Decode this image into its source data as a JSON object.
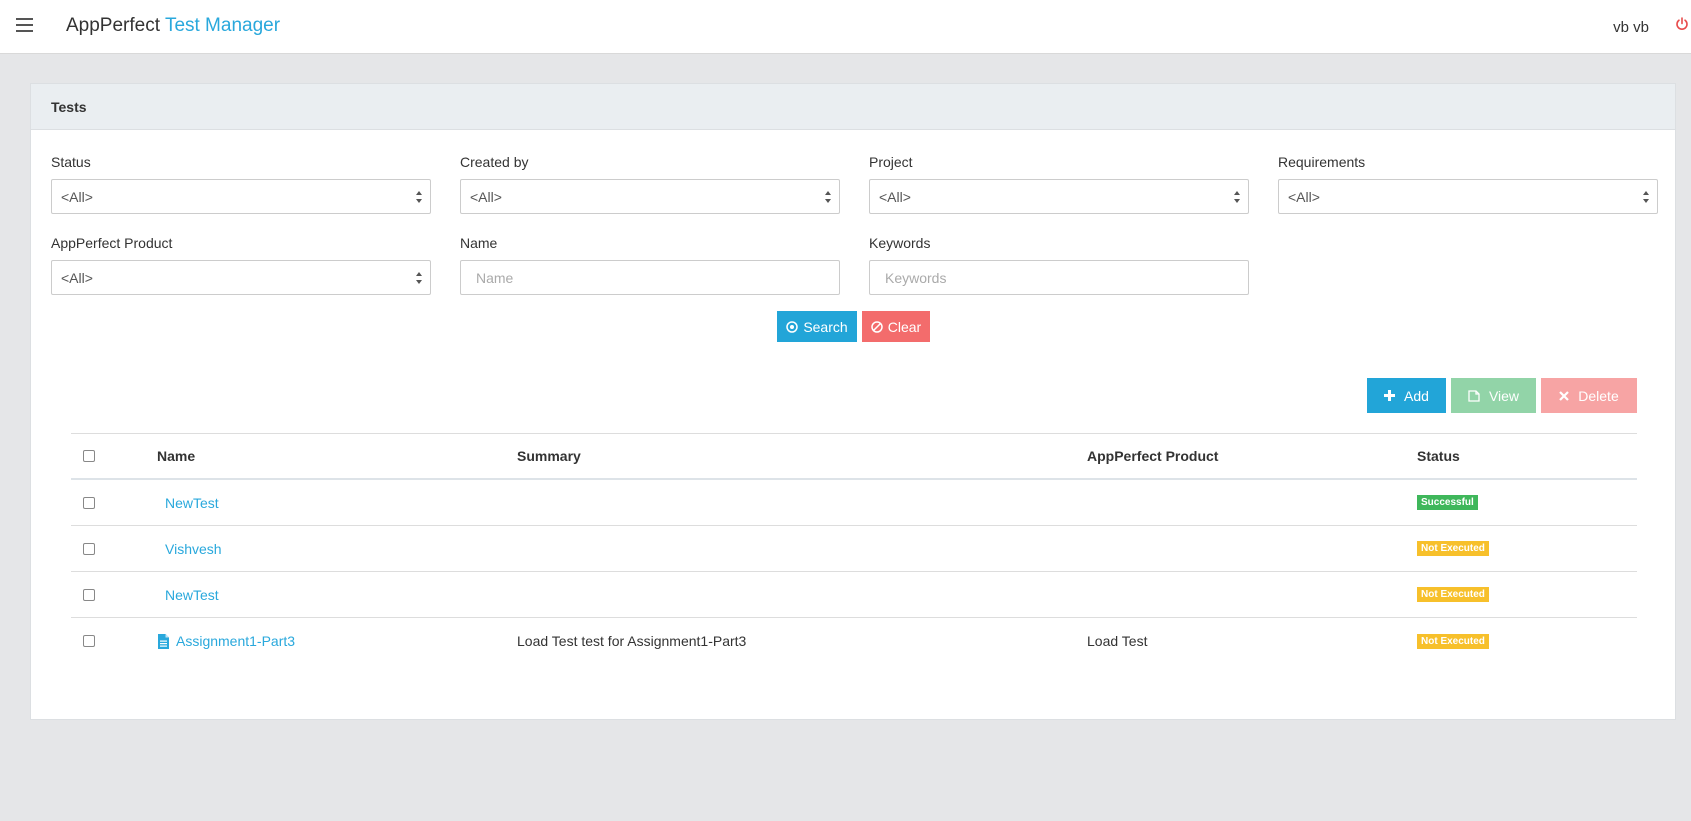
{
  "header": {
    "brand_main": "AppPerfect",
    "brand_accent": "Test Manager",
    "user_name": "vb vb"
  },
  "panel": {
    "title": "Tests"
  },
  "filters": {
    "status": {
      "label": "Status",
      "value": "<All>"
    },
    "created_by": {
      "label": "Created by",
      "value": "<All>"
    },
    "project": {
      "label": "Project",
      "value": "<All>"
    },
    "requirements": {
      "label": "Requirements",
      "value": "<All>"
    },
    "product": {
      "label": "AppPerfect Product",
      "value": "<All>"
    },
    "name": {
      "label": "Name",
      "placeholder": "Name"
    },
    "keywords": {
      "label": "Keywords",
      "placeholder": "Keywords"
    }
  },
  "actions": {
    "search": "Search",
    "clear": "Clear",
    "add": "Add",
    "view": "View",
    "delete": "Delete"
  },
  "table": {
    "columns": [
      "Name",
      "Summary",
      "AppPerfect Product",
      "Status"
    ],
    "rows": [
      {
        "name": "NewTest",
        "summary": "",
        "product": "",
        "status": "Successful",
        "has_icon": false
      },
      {
        "name": "Vishvesh",
        "summary": "",
        "product": "",
        "status": "Not Executed",
        "has_icon": false
      },
      {
        "name": "NewTest",
        "summary": "",
        "product": "",
        "status": "Not Executed",
        "has_icon": false
      },
      {
        "name": "Assignment1-Part3",
        "summary": "Load Test test for Assignment1-Part3",
        "product": "Load Test",
        "status": "Not Executed",
        "has_icon": true
      }
    ]
  },
  "colors": {
    "accent": "#29a8dc",
    "success": "#3fb75b",
    "warning": "#f7c02b",
    "danger": "#f36c6c",
    "power": "#e84c4c"
  },
  "icons": {
    "menu": "hamburger-icon",
    "power": "power-icon",
    "search": "circle-dot-icon",
    "clear": "ban-icon",
    "add": "plus-icon",
    "view": "edit-icon",
    "delete": "times-icon",
    "row_doc": "document-icon",
    "select": "sort-arrows-icon"
  }
}
